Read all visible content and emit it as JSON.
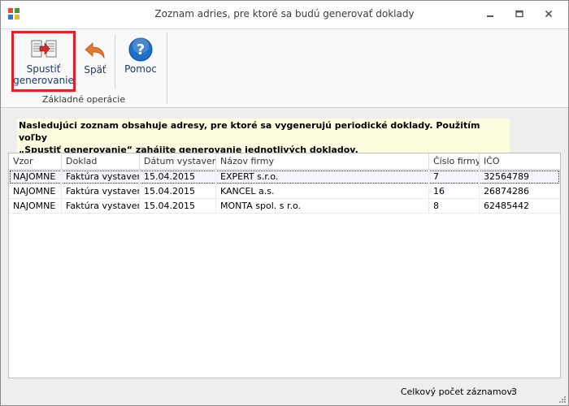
{
  "window": {
    "title": "Zoznam adries, pre ktoré sa budú generovať doklady"
  },
  "ribbon": {
    "run_label_1": "Spustiť",
    "run_label_2": "generovanie",
    "back_label": "Späť",
    "help_label": "Pomoc",
    "group_label": "Základné operácie"
  },
  "info": {
    "line1": "Nasledujúci zoznam obsahuje adresy, pre ktoré sa vygenerujú periodické doklady. Použitím voľby",
    "line2": "„Spustiť generovanie“ zahájite generovanie jednotlivých dokladov."
  },
  "grid": {
    "columns": [
      "Vzor",
      "Doklad",
      "Dátum vystaveni",
      "Názov firmy",
      "Číslo firmy",
      "IČO"
    ],
    "rows": [
      [
        "NAJOMNE",
        "Faktúra vystavená",
        "15.04.2015",
        "EXPERT s.r.o.",
        "7",
        "32564789"
      ],
      [
        "NAJOMNE",
        "Faktúra vystavená",
        "15.04.2015",
        "KANCEL a.s.",
        "16",
        "26874286"
      ],
      [
        "NAJOMNE",
        "Faktúra vystavená",
        "15.04.2015",
        "MONTA spol. s r.o.",
        "8",
        "62485442"
      ]
    ]
  },
  "status": {
    "label": "Celkový počet záznamov:",
    "count": "3"
  },
  "colors": {
    "highlight_border": "#e32029",
    "info_bg": "#fdfde0",
    "help_blue": "#1e6fc8",
    "back_orange": "#e07a2a"
  }
}
